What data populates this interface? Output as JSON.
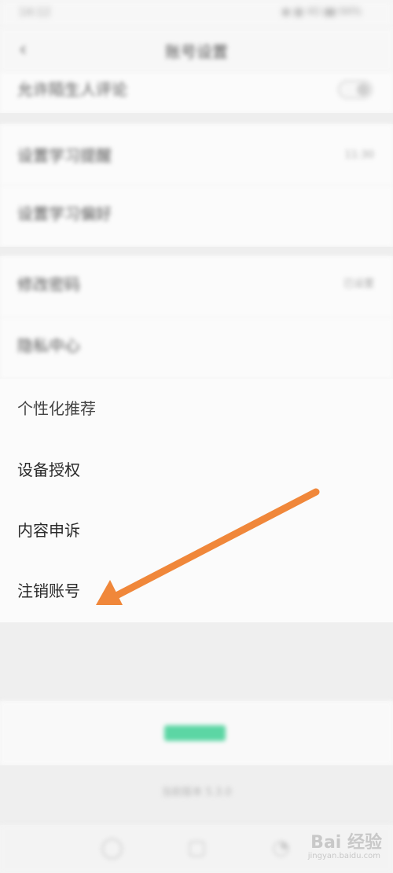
{
  "status_bar": {
    "time": "14:12",
    "icons": "◉ ▦ 4G ▮▮ 94%"
  },
  "nav": {
    "back_icon": "back-chevron-icon",
    "title": "账号设置"
  },
  "rows": [
    {
      "label": "允许陌生人评论",
      "value": "",
      "toggle": true
    },
    {
      "label": "设置学习提醒",
      "value": "11:30",
      "toggle": false
    },
    {
      "label": "设置学习偏好",
      "value": "",
      "toggle": false
    },
    {
      "label": "修改密码",
      "value": "已设置",
      "toggle": false
    },
    {
      "label": "隐私中心",
      "value": "",
      "toggle": false
    },
    {
      "label": "个性化推荐",
      "value": "",
      "toggle": false
    },
    {
      "label": "设备授权",
      "value": "",
      "toggle": false
    },
    {
      "label": "内容申诉",
      "value": "",
      "toggle": false
    },
    {
      "label": "注销账号",
      "value": "",
      "toggle": false
    }
  ],
  "footer": {
    "bottom_text": "当前版本 5.3.0"
  },
  "tabbar": {
    "icons": [
      "home-icon",
      "course-icon",
      "profile-icon"
    ]
  },
  "watermark": {
    "text": "Bai 经验",
    "url": "jingyan.baidu.com"
  },
  "colors": {
    "accent_green": "#5cd6a4",
    "arrow": "#f0873a"
  }
}
